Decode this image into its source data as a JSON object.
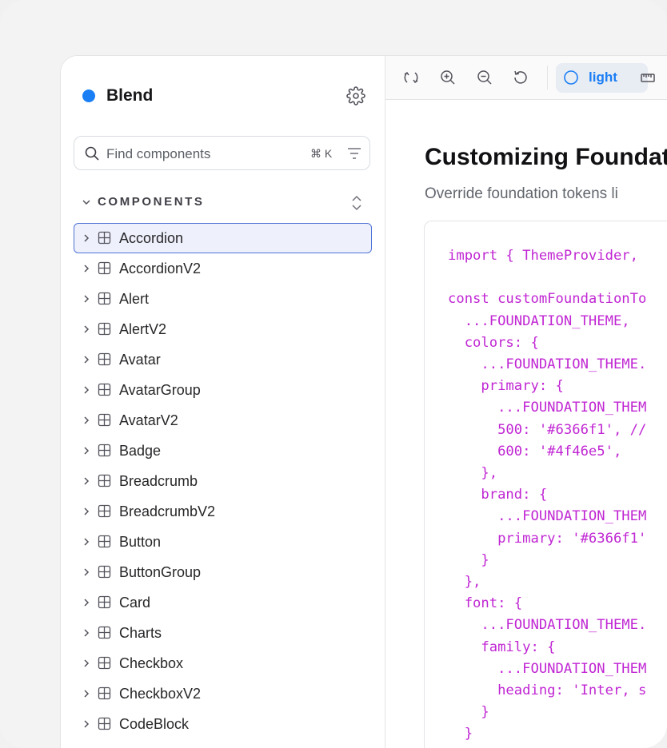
{
  "sidebar": {
    "brand": "Blend",
    "search": {
      "placeholder": "Find components",
      "shortcut": "⌘ K"
    },
    "section": "COMPONENTS",
    "items": [
      {
        "label": "Accordion",
        "selected": true
      },
      {
        "label": "AccordionV2"
      },
      {
        "label": "Alert"
      },
      {
        "label": "AlertV2"
      },
      {
        "label": "Avatar"
      },
      {
        "label": "AvatarGroup"
      },
      {
        "label": "AvatarV2"
      },
      {
        "label": "Badge"
      },
      {
        "label": "Breadcrumb"
      },
      {
        "label": "BreadcrumbV2"
      },
      {
        "label": "Button"
      },
      {
        "label": "ButtonGroup"
      },
      {
        "label": "Card"
      },
      {
        "label": "Charts"
      },
      {
        "label": "Checkbox"
      },
      {
        "label": "CheckboxV2"
      },
      {
        "label": "CodeBlock"
      }
    ]
  },
  "toolbar": {
    "icons": [
      "reset-icon",
      "zoom-in-icon",
      "zoom-out-icon",
      "refresh-icon"
    ],
    "theme_label": "light"
  },
  "doc": {
    "title": "Customizing Foundat",
    "subtitle": "Override foundation tokens li",
    "code_lines": [
      "import { ThemeProvider,",
      "",
      "const customFoundationTo",
      "  ...FOUNDATION_THEME,",
      "  colors: {",
      "    ...FOUNDATION_THEME.",
      "    primary: {",
      "      ...FOUNDATION_THEM",
      "      500: '#6366f1', //",
      "      600: '#4f46e5',",
      "    },",
      "    brand: {",
      "      ...FOUNDATION_THEM",
      "      primary: '#6366f1'",
      "    }",
      "  },",
      "  font: {",
      "    ...FOUNDATION_THEME.",
      "    family: {",
      "      ...FOUNDATION_THEM",
      "      heading: 'Inter, s",
      "    }",
      "  }",
      "}"
    ]
  },
  "colors": {
    "accent": "#1a7ef5",
    "code": "#c026d3",
    "selected_border": "#4f74d6"
  }
}
